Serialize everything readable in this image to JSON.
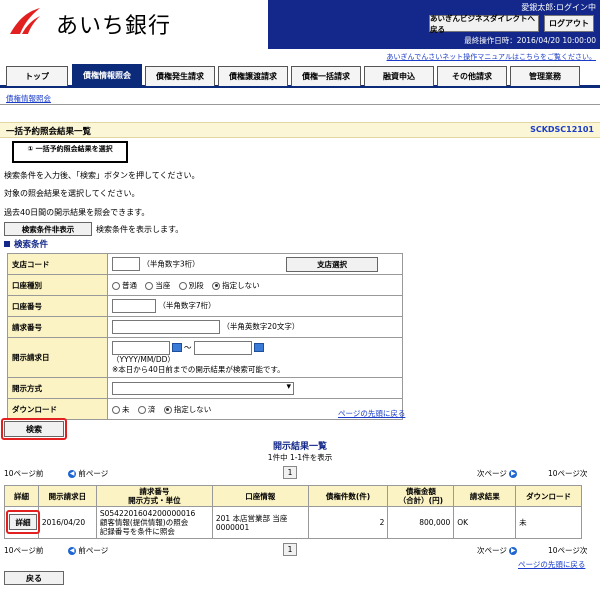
{
  "header": {
    "bank_name": "あいち銀行",
    "user_name": "愛銀太郎:ログイン中",
    "direct_button": "あいぎんビジネスダイレクトへ戻る",
    "logout_button": "ログアウト",
    "last_operation": "最終操作日時：2016/04/20 10:00:00",
    "manual_link": "あいぎんでんさいネット操作マニュアルはこちらをご覧ください。",
    "logo_color": "#e32020"
  },
  "nav": {
    "tabs": [
      {
        "label": "トップ"
      },
      {
        "label": "債権情報照会"
      },
      {
        "label": "債権発生請求"
      },
      {
        "label": "債権譲渡請求"
      },
      {
        "label": "債権一括請求"
      },
      {
        "label": "融資申込"
      },
      {
        "label": "その他請求"
      },
      {
        "label": "管理業務"
      }
    ],
    "active_color": "#0c2a7a",
    "sub_link": "債権情報照会"
  },
  "page": {
    "title": "一括予約照会結果一覧",
    "screen_id": "SCKDSC12101",
    "step": "① 一括予約照会結果を選択",
    "messages": [
      "検索条件を入力後、「検索」ボタンを押してください。",
      "対象の照会結果を選択してください。",
      "過去40日間の開示結果を照会できます。"
    ],
    "hide_conditions_button": "検索条件非表示",
    "hide_conditions_text": "検索条件を表示します。",
    "conditions_heading": "検索条件"
  },
  "form": {
    "branch_code": {
      "label": "支店コード",
      "hint": "（半角数字3桁）",
      "select_button": "支店選択"
    },
    "account_type": {
      "label": "口座種別",
      "options": [
        "普通",
        "当座",
        "別段",
        "指定しない"
      ],
      "selected": "指定しない"
    },
    "account_number": {
      "label": "口座番号",
      "hint": "（半角数字7桁）"
    },
    "request_number": {
      "label": "請求番号",
      "hint": "（半角英数字20文字）"
    },
    "disclosure_date": {
      "label": "開示請求日",
      "separator": "〜",
      "format": "（YYYY/MM/DD）",
      "note": "※本日から40日前までの開示結果が検索可能です。"
    },
    "disclosure_method": {
      "label": "開示方式"
    },
    "download": {
      "label": "ダウンロード",
      "options": [
        "未",
        "済",
        "指定しない"
      ],
      "selected": "指定しない"
    }
  },
  "to_top_link": "ページの先頭に戻る",
  "search_button": "検索",
  "results": {
    "title": "開示結果一覧",
    "count_text": "1件中 1-1件を表示",
    "prev10": "10ページ前",
    "prev": "前ページ",
    "next": "次ページ",
    "next10": "10ページ次",
    "page": "1",
    "columns": [
      "詳細",
      "開示請求日",
      "請求番号\n開示方式・単位",
      "口座情報",
      "債権件数(件)",
      "債権金額\n（合計）(円)",
      "請求結果",
      "ダウンロード"
    ],
    "rows": [
      {
        "detail": "詳細",
        "date": "2016/04/20",
        "request_line1": "S0542201604200000016",
        "request_line2": "顧客情報(提供情報)の照会",
        "request_line3": "記録番号を条件に照会",
        "account_line1": "201 本店営業部 当座",
        "account_line2": "0000001",
        "count": "2",
        "amount": "800,000",
        "result": "OK",
        "download": "未"
      }
    ]
  },
  "back_button": "戻る"
}
